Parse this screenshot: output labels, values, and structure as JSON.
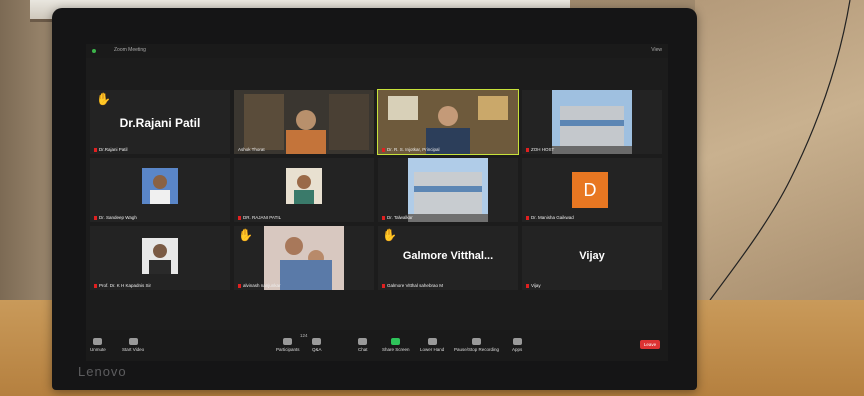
{
  "window": {
    "title": "Zoom Meeting",
    "view_label": "View"
  },
  "participants": [
    {
      "label": "Dr.Rajani Patil",
      "display_name": "Dr.Rajani Patil",
      "hand": true
    },
    {
      "label": "Ashok Thorat"
    },
    {
      "label": "Dr. R. S. Injotkar, Principal"
    },
    {
      "label": "ZOH HOST"
    },
    {
      "label": "Dr. Sandeep Wagh"
    },
    {
      "label": "DR. RAJANI PATIL"
    },
    {
      "label": "Dr. Talwalkar"
    },
    {
      "label": "Dr. Manisha Gaikwad",
      "avatar_letter": "D"
    },
    {
      "label": "Prof. Dr. K H Kapadnis Sir"
    },
    {
      "label": "alvinash nanjunkar",
      "hand": true
    },
    {
      "label": "Galmore Vitthal sahebrao M",
      "display_name": "Galmore  Vitthal...",
      "hand": true
    },
    {
      "label": "Vijay",
      "display_name": "Vijay"
    }
  ],
  "toolbar": {
    "unmute": "Unmute",
    "start_video": "Start Video",
    "participants": "Participants",
    "participants_count": "124",
    "qa": "Q&A",
    "chat": "Chat",
    "share_screen": "Share Screen",
    "lower_hand": "Lower Hand",
    "pause_recording": "Pause/Stop Recording",
    "apps": "Apps",
    "leave": "Leave"
  },
  "laptop_brand": "Lenovo",
  "colors": {
    "active_speaker": "#c7e23a",
    "leave": "#dd3333",
    "avatar": "#e87722",
    "hand": "#f5c518"
  }
}
